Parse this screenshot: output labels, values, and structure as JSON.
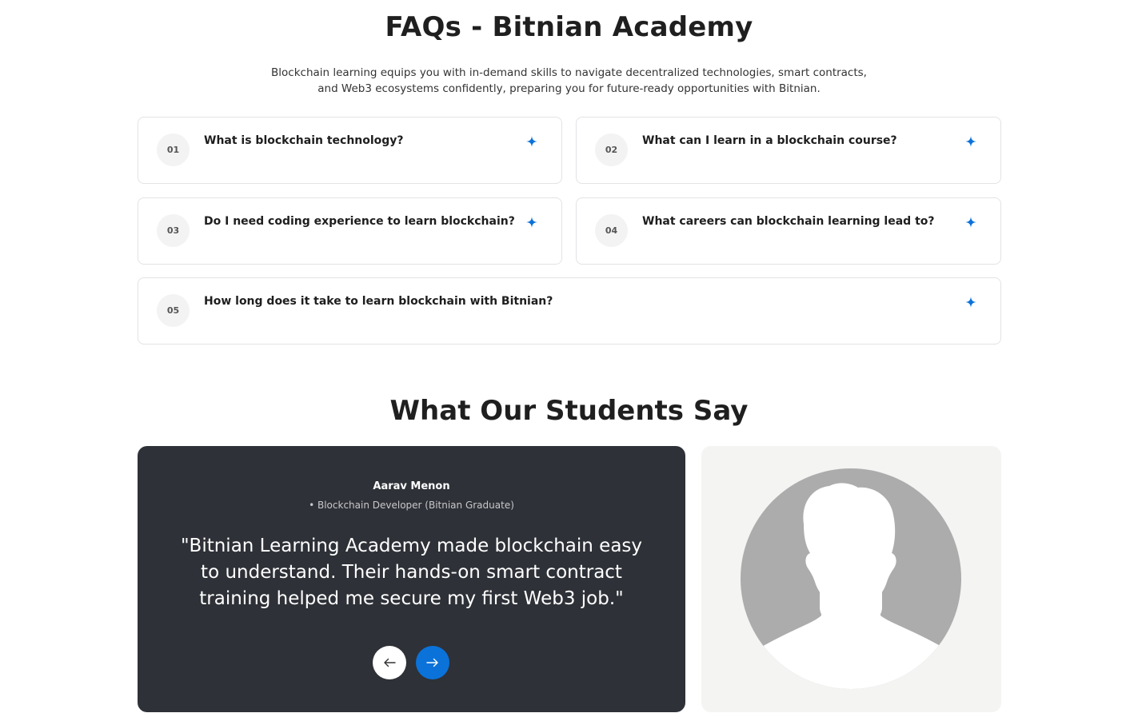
{
  "faq": {
    "title": "FAQs - Bitnian Academy",
    "subtitle_line1": "Blockchain learning equips you with in-demand skills to navigate decentralized technologies, smart contracts,",
    "subtitle_line2": "and Web3 ecosystems confidently, preparing you for future-ready opportunities with Bitnian.",
    "items": [
      {
        "num": "01",
        "question": "What is blockchain technology?"
      },
      {
        "num": "02",
        "question": "What can I learn in a blockchain course?"
      },
      {
        "num": "03",
        "question": "Do I need coding experience to learn blockchain?"
      },
      {
        "num": "04",
        "question": "What careers can blockchain learning lead to?"
      },
      {
        "num": "05",
        "question": "How long does it take to learn blockchain with Bitnian?"
      }
    ],
    "expand_icon": "plus-sparkle-icon",
    "accent_color": "#0b72d9"
  },
  "testimonials": {
    "title": "What Our Students Say",
    "current": {
      "name": "Aarav Menon",
      "role": "• Blockchain Developer (Bitnian Graduate)",
      "quote": "\"Bitnian Learning Academy made blockchain easy to understand. Their hands-on smart contract training helped me secure my first Web3 job.\""
    },
    "prev_icon": "arrow-left-icon",
    "next_icon": "arrow-right-icon",
    "avatar_icon": "user-silhouette-icon",
    "card_color": "#2e3137"
  }
}
